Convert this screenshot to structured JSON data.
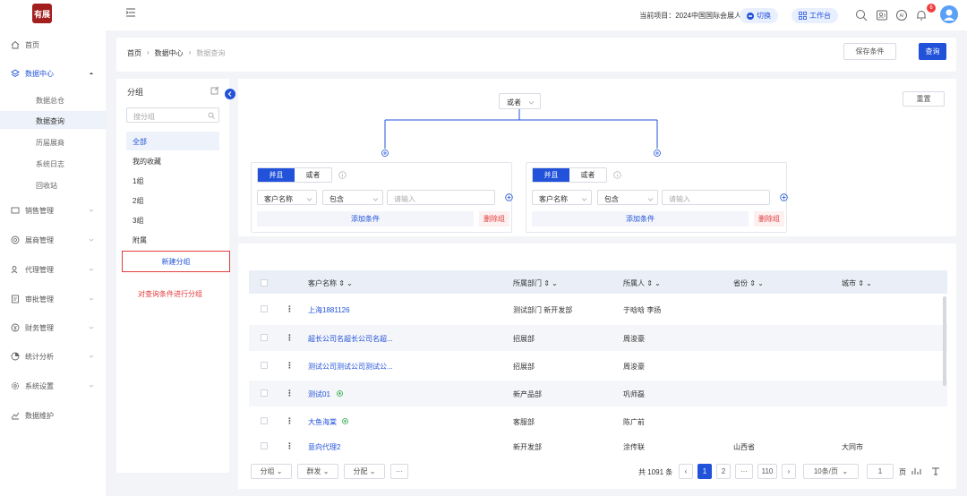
{
  "sidebar": {
    "logo_text": "有展",
    "items": [
      {
        "label": "首页",
        "icon": "home-icon"
      },
      {
        "label": "数据中心",
        "icon": "layers-icon"
      },
      {
        "label": "销售管理",
        "icon": "sales-icon"
      },
      {
        "label": "展商管理",
        "icon": "exhibitor-icon"
      },
      {
        "label": "代理管理",
        "icon": "agent-icon"
      },
      {
        "label": "审批管理",
        "icon": "approval-icon"
      },
      {
        "label": "财务管理",
        "icon": "finance-icon"
      },
      {
        "label": "统计分析",
        "icon": "chart-icon"
      },
      {
        "label": "系统设置",
        "icon": "settings-icon"
      },
      {
        "label": "数据维护",
        "icon": "maintenance-icon"
      }
    ],
    "sub_items": [
      "数据总仓",
      "数据查询",
      "历届展商",
      "系统日志",
      "回收站"
    ]
  },
  "topbar": {
    "project": "当前项目：2024中国国际会展人大会",
    "switch_label": "切换",
    "workbench_label": "工作台",
    "notification_count": "6"
  },
  "breadcrumb": [
    "首页",
    "数据中心",
    "数据查询"
  ],
  "actions": {
    "save": "保存条件",
    "query": "查询",
    "reset": "重置"
  },
  "groups": {
    "title": "分组",
    "search_placeholder": "搜分组",
    "items": [
      "全部",
      "我的收藏",
      "1组",
      "2组",
      "3组",
      "附属"
    ],
    "new_group": "新建分组",
    "note": "对查询条件进行分组"
  },
  "conditions": {
    "root_logic": "或者",
    "boxes": [
      {
        "and": "并且",
        "or": "或者",
        "field": "客户名称",
        "op": "包含",
        "placeholder": "请输入",
        "add": "添加条件",
        "delete": "删除组"
      },
      {
        "and": "并且",
        "or": "或者",
        "field": "客户名称",
        "op": "包含",
        "placeholder": "请输入",
        "add": "添加条件",
        "delete": "删除组"
      }
    ]
  },
  "table": {
    "headers": [
      "客户名称",
      "所属部门",
      "所属人",
      "省份",
      "城市"
    ],
    "rows": [
      {
        "name": "上海1881126",
        "dept": "测试部门  新开发部",
        "owner": "于晗晗  李扬",
        "province": "",
        "city": "",
        "verified": false
      },
      {
        "name": "超长公司名超长公司名超...",
        "dept": "招展部",
        "owner": "周浚豪",
        "province": "",
        "city": "",
        "verified": false
      },
      {
        "name": "测试公司测试公司测试公...",
        "dept": "招展部",
        "owner": "周浚豪",
        "province": "",
        "city": "",
        "verified": false
      },
      {
        "name": "测试01",
        "dept": "新产品部",
        "owner": "巩师磊",
        "province": "",
        "city": "",
        "verified": true
      },
      {
        "name": "大鱼海棠",
        "dept": "客服部",
        "owner": "陈广前",
        "province": "",
        "city": "",
        "verified": true
      },
      {
        "name": "意向代理2",
        "dept": "新开发部",
        "owner": "涂传联",
        "province": "山西省",
        "city": "大同市",
        "verified": false
      }
    ]
  },
  "footer": {
    "batch": [
      "分组",
      "群发",
      "分配",
      "···"
    ],
    "total": "共 1091 条",
    "pages": [
      "1",
      "2",
      "···",
      "110"
    ],
    "page_size": "10条/页",
    "goto": "1",
    "page_unit": "页"
  },
  "colors": {
    "accent": "#2152d9",
    "danger": "#e23d3d",
    "header_bg": "#e9eef7"
  }
}
